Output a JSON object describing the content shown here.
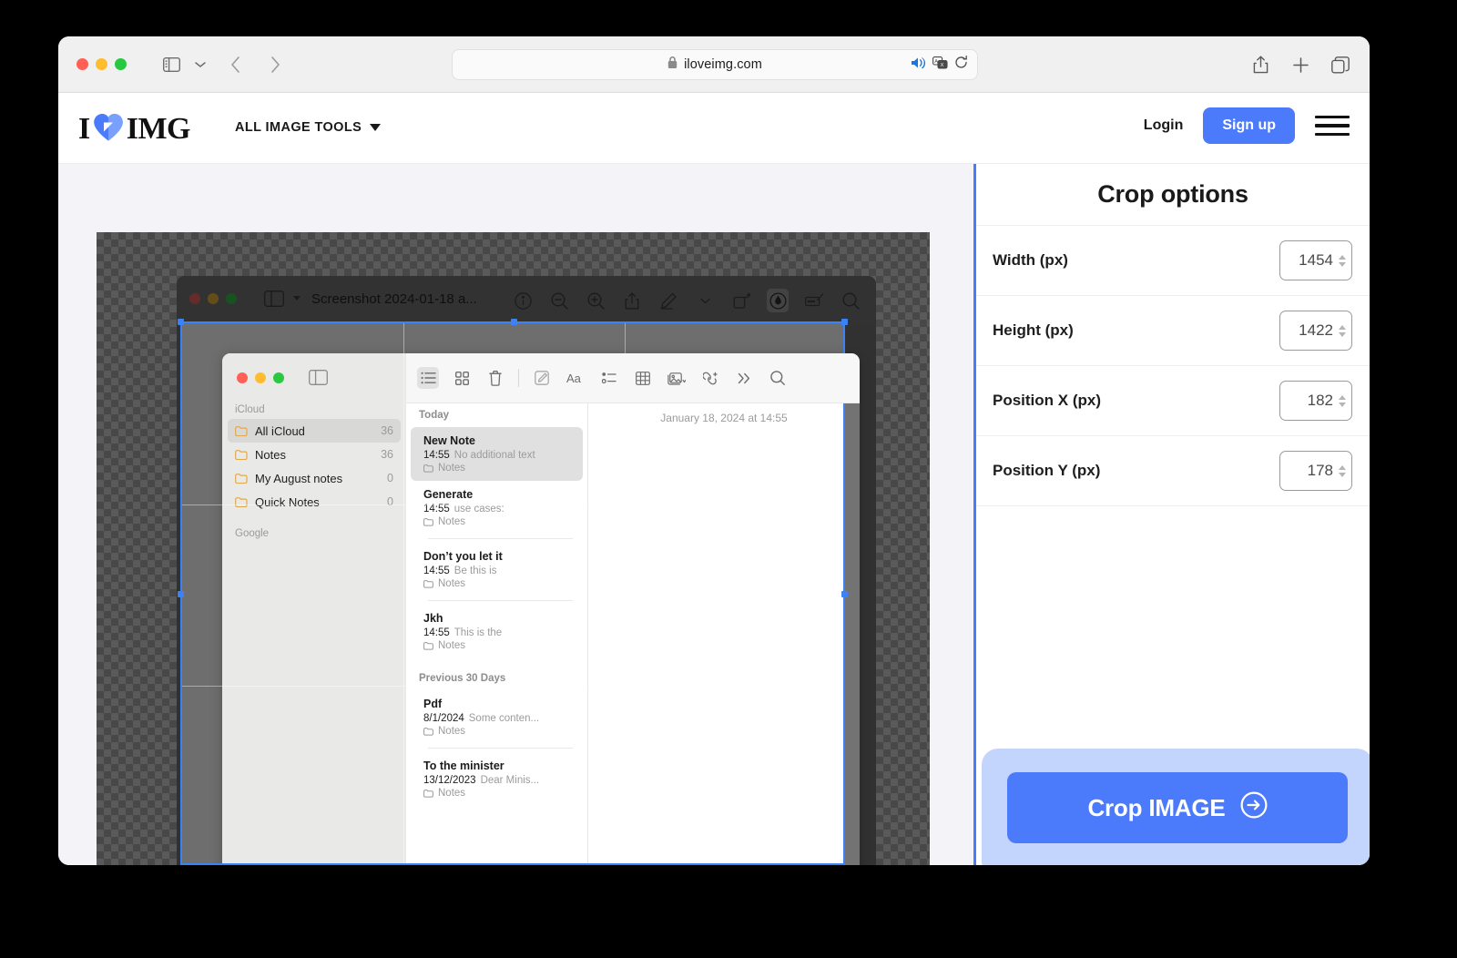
{
  "browser": {
    "url": "iloveimg.com",
    "icons": {
      "sidebar": "sidebar-toggle-icon",
      "chevron": "chevron-down-icon",
      "back": "back-arrow-icon",
      "forward": "forward-arrow-icon",
      "lock": "lock-icon",
      "audio": "speaker-icon",
      "translate": "translate-icon",
      "reload": "reload-icon",
      "share": "share-icon",
      "newtab": "plus-icon",
      "tabs": "tabs-overview-icon"
    }
  },
  "site_header": {
    "logo_i": "I",
    "logo_img": "IMG",
    "nav_all_tools": "ALL IMAGE TOOLS",
    "login_label": "Login",
    "signup_label": "Sign up"
  },
  "options_panel": {
    "title": "Crop options",
    "rows": [
      {
        "label": "Width (px)",
        "value": "1454"
      },
      {
        "label": "Height (px)",
        "value": "1422"
      },
      {
        "label": "Position X (px)",
        "value": "182"
      },
      {
        "label": "Position Y (px)",
        "value": "178"
      }
    ],
    "action_label": "Crop IMAGE",
    "accent_color": "#4b7bfb",
    "action_wrap_color": "#c3d4fd"
  },
  "embedded_screenshot": {
    "preview_window": {
      "title": "Screenshot 2024-01-18 a...",
      "tools": [
        "info-icon",
        "zoom-out-icon",
        "zoom-in-icon",
        "share-icon",
        "markup-pen-icon",
        "chevron-down-icon",
        "rotate-icon",
        "annotate-icon",
        "signature-icon",
        "search-icon"
      ]
    },
    "notes_app": {
      "toolbar_tools": [
        "list-view-icon",
        "grid-view-icon",
        "trash-icon",
        "compose-icon",
        "format-aa-icon",
        "checklist-icon",
        "table-icon",
        "media-icon",
        "link-icon",
        "more-icon",
        "search-icon"
      ],
      "sidebar": {
        "sections": [
          {
            "label": "iCloud",
            "items": [
              {
                "name": "All iCloud",
                "count": "36",
                "selected": true
              },
              {
                "name": "Notes",
                "count": "36",
                "selected": false
              },
              {
                "name": "My August notes",
                "count": "0",
                "selected": false
              },
              {
                "name": "Quick Notes",
                "count": "0",
                "selected": false
              }
            ]
          },
          {
            "label": "Google",
            "items": []
          }
        ]
      },
      "note_groups": [
        {
          "label": "Today",
          "notes": [
            {
              "title": "New Note",
              "time": "14:55",
              "snippet": "No additional text",
              "folder": "Notes",
              "selected": true
            },
            {
              "title": "Generate",
              "time": "14:55",
              "snippet": "use cases:",
              "folder": "Notes",
              "selected": false
            },
            {
              "title": "Don’t you let it",
              "time": "14:55",
              "snippet": "Be this is",
              "folder": "Notes",
              "selected": false
            },
            {
              "title": "Jkh",
              "time": "14:55",
              "snippet": "This is the",
              "folder": "Notes",
              "selected": false
            }
          ]
        },
        {
          "label": "Previous 30 Days",
          "notes": [
            {
              "title": "Pdf",
              "time": "8/1/2024",
              "snippet": "Some conten...",
              "folder": "Notes",
              "selected": false
            },
            {
              "title": "To the minister",
              "time": "13/12/2023",
              "snippet": "Dear Minis...",
              "folder": "Notes",
              "selected": false
            }
          ]
        }
      ],
      "detail_date": "January 18, 2024 at 14:55"
    }
  }
}
